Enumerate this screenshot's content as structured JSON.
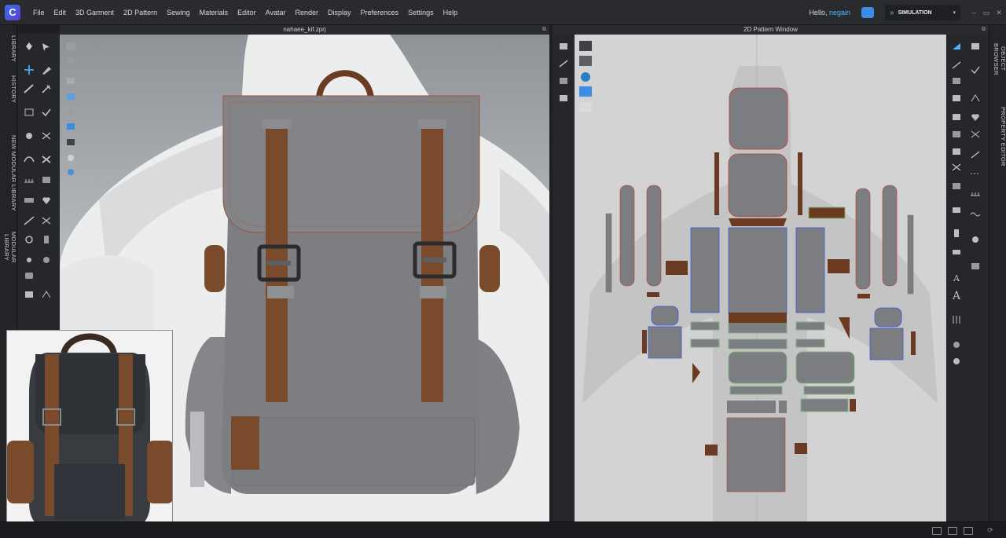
{
  "menu": {
    "logo": "C",
    "items": [
      "File",
      "Edit",
      "3D Garment",
      "2D Pattern",
      "Sewing",
      "Materials",
      "Editor",
      "Avatar",
      "Render",
      "Display",
      "Preferences",
      "Settings",
      "Help"
    ]
  },
  "user": {
    "greeting": "Hello,",
    "name": "negain"
  },
  "simulation": {
    "label": "SIMULATION"
  },
  "window_controls": [
    "–",
    "▭",
    "✕"
  ],
  "left_tabs": [
    "LIBRARY",
    "HISTORY",
    "NEW MODULAR LIBRARY",
    "MODULAR LIBRARY"
  ],
  "right_tabs": [
    "OBJECT BROWSER",
    "PROPERTY EDITOR"
  ],
  "viewport3d": {
    "title": "nahaee_kif.zprj"
  },
  "pattern_window": {
    "title": "2D Pattern Window"
  },
  "colors": {
    "accent": "#4fb6ff",
    "fabric_grey": "#808285",
    "leather_brown": "#6b3a22",
    "seam_red": "#c0392b",
    "selection_blue": "#3b5bdb"
  }
}
